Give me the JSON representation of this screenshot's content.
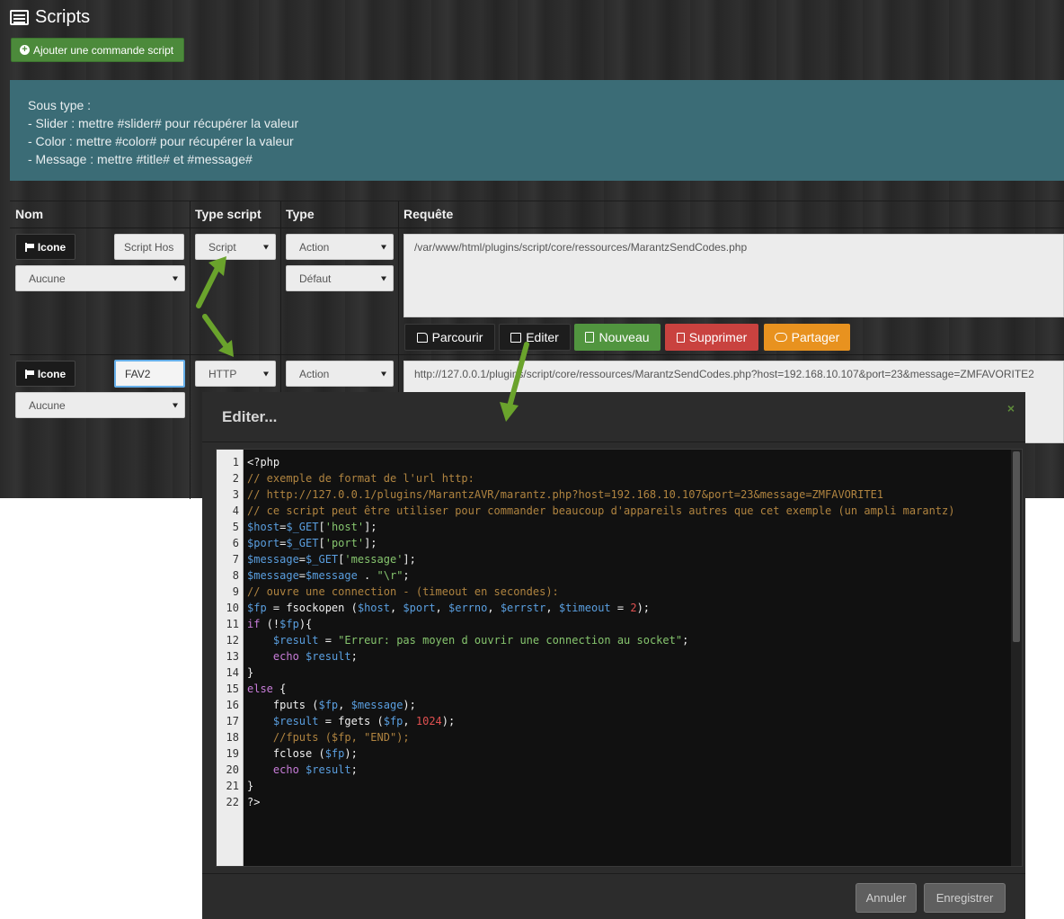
{
  "page": {
    "title": "Scripts",
    "add_button": "Ajouter une commande script"
  },
  "info": {
    "lines": [
      "Sous type :",
      "- Slider : mettre #slider# pour récupérer la valeur",
      "- Color : mettre #color# pour récupérer la valeur",
      "- Message : mettre #title# et #message#"
    ]
  },
  "table": {
    "headers": [
      "Nom",
      "Type script",
      "Type",
      "Requête"
    ],
    "rows": [
      {
        "icon_button": "Icone",
        "name": "Script Hos",
        "name_select": "Aucune",
        "type_script": "Script",
        "type": "Action",
        "subtype": "Défaut",
        "request": "/var/www/html/plugins/script/core/ressources/MarantzSendCodes.php",
        "buttons": [
          "Parcourir",
          "Editer",
          "Nouveau",
          "Supprimer",
          "Partager"
        ]
      },
      {
        "icon_button": "Icone",
        "name": "FAV2",
        "name_select": "Aucune",
        "type_script": "HTTP",
        "type": "Action",
        "request": "http://127.0.0.1/plugins/script/core/ressources/MarantzSendCodes.php?host=192.168.10.107&port=23&message=ZMFAVORITE2"
      }
    ]
  },
  "modal": {
    "title": "Editer...",
    "close": "×",
    "cancel": "Annuler",
    "save": "Enregistrer",
    "code": [
      "<?php",
      "// exemple de format de l'url http:",
      "// http://127.0.0.1/plugins/MarantzAVR/marantz.php?host=192.168.10.107&port=23&message=ZMFAVORITE1",
      "// ce script peut être utiliser pour commander beaucoup d'appareils autres que cet exemple (un ampli marantz)",
      "$host=$_GET['host'];",
      "$port=$_GET['port'];",
      "$message=$_GET['message'];",
      "$message=$message . \"\\r\";",
      "// ouvre une connection - (timeout en secondes):",
      "$fp = fsockopen ($host, $port, $errno, $errstr, $timeout = 2);",
      "if (!$fp){",
      "    $result = \"Erreur: pas moyen d ouvrir une connection au socket\";",
      "    echo $result;",
      "}",
      "else {",
      "    fputs ($fp, $message);",
      "    $result = fgets ($fp, 1024);",
      "    //fputs ($fp, \"END\");",
      "    fclose ($fp);",
      "    echo $result;",
      "}",
      "?>"
    ]
  },
  "colors": {
    "accent_arrow": "#6aa32c",
    "info_bg": "#3b6c76"
  }
}
